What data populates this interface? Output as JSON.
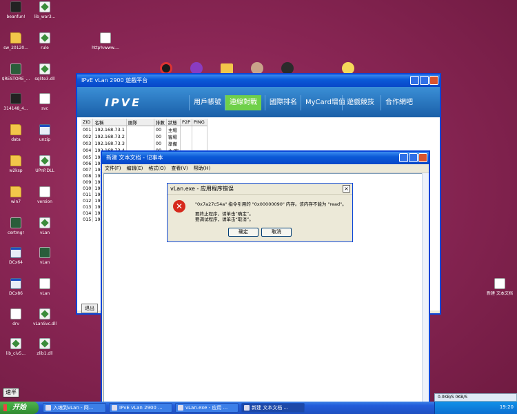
{
  "desktop": {
    "icons": [
      {
        "label": "beanfun!",
        "type": "dark"
      },
      {
        "label": "lib_war3...",
        "type": "dll"
      },
      {
        "label": "sw_20120...",
        "type": "folder"
      },
      {
        "label": "rule",
        "type": "dll"
      },
      {
        "label": "http%www....",
        "type": "txt"
      },
      {
        "label": "$RESTORE_...",
        "type": "app"
      },
      {
        "label": "sqlite3.dll",
        "type": "dll"
      },
      {
        "label": "314148_4...",
        "type": "dark"
      },
      {
        "label": "svc",
        "type": "txt"
      },
      {
        "label": "data",
        "type": "folder"
      },
      {
        "label": "unzip",
        "type": "exe"
      },
      {
        "label": "w2ksp",
        "type": "folder"
      },
      {
        "label": "UPnP.DLL",
        "type": "dll"
      },
      {
        "label": "win7",
        "type": "folder"
      },
      {
        "label": "version",
        "type": "txt"
      },
      {
        "label": "certmgr",
        "type": "app"
      },
      {
        "label": "vLan",
        "type": "dll"
      },
      {
        "label": "DCx64",
        "type": "exe"
      },
      {
        "label": "vLan",
        "type": "app"
      },
      {
        "label": "DCx86",
        "type": "exe"
      },
      {
        "label": "vLan",
        "type": "txt"
      },
      {
        "label": "drv",
        "type": "txt"
      },
      {
        "label": "vLanSvc.dll",
        "type": "dll"
      },
      {
        "label": "lib_civ5...",
        "type": "dll"
      },
      {
        "label": "zlib1.dll",
        "type": "dll"
      },
      {
        "label": "新建 文本文档",
        "type": "txt"
      }
    ]
  },
  "ipve_window": {
    "title": "IPvE vLan 2900 遊戲平台",
    "logo": "IPVE",
    "tabs": [
      {
        "label": "用戶帳號"
      },
      {
        "label": "連線對戰"
      },
      {
        "label": "國際排名"
      },
      {
        "label": "MyCard增值"
      },
      {
        "label": "遊戲競技"
      },
      {
        "label": "合作網吧"
      }
    ],
    "table": {
      "headers": [
        "ZID",
        "名稱",
        "團隊",
        "排數",
        "狀態",
        "P2P",
        "PING"
      ],
      "rows": [
        [
          "001",
          "192.168.73.1",
          "",
          "00",
          "主場",
          "",
          ""
        ],
        [
          "002",
          "192.168.73.2",
          "",
          "00",
          "客場",
          "",
          ""
        ],
        [
          "003",
          "192.168.73.3",
          "",
          "00",
          "準備",
          "",
          ""
        ],
        [
          "004",
          "192.168.73.4",
          "",
          "00",
          "主/客",
          "",
          ""
        ],
        [
          "005",
          "19",
          "",
          "",
          "",
          "",
          ""
        ],
        [
          "006",
          "19",
          "",
          "",
          "",
          "",
          ""
        ],
        [
          "007",
          "19",
          "",
          "",
          "",
          "",
          ""
        ],
        [
          "008",
          "19",
          "",
          "",
          "",
          "",
          ""
        ],
        [
          "009",
          "19",
          "",
          "",
          "",
          "",
          ""
        ],
        [
          "010",
          "19",
          "",
          "",
          "",
          "",
          ""
        ],
        [
          "011",
          "19",
          "",
          "",
          "",
          "",
          ""
        ],
        [
          "012",
          "19",
          "",
          "",
          "",
          "",
          ""
        ],
        [
          "013",
          "19",
          "",
          "",
          "",
          "",
          ""
        ],
        [
          "014",
          "19",
          "",
          "",
          "",
          "",
          ""
        ],
        [
          "015",
          "19",
          "",
          "",
          "",
          "",
          ""
        ]
      ]
    },
    "exit_label": "退出"
  },
  "notepad": {
    "title": "新建 文本文档 - 记事本",
    "menu": [
      "文件(F)",
      "编辑(E)",
      "格式(O)",
      "查看(V)",
      "帮助(H)"
    ]
  },
  "error_dialog": {
    "title": "vLan.exe - 应用程序错误",
    "message1": "\"0x7a27c54a\" 指令引用的 \"0x00000090\" 内存。该内存不能为 \"read\"。",
    "message2": "要终止程序，请单击“确定”。",
    "message3": "要调试程序，请单击“取消”。",
    "ok_label": "确定",
    "cancel_label": "取消"
  },
  "taskbar": {
    "start_label": "开始",
    "buttons": [
      {
        "label": "入魂到vLan - 网..."
      },
      {
        "label": "IPvE vLan 2900 ..."
      },
      {
        "label": "vLan.exe - 应用 ..."
      },
      {
        "label": "新建 文本文档 ..."
      }
    ],
    "clock": "19:20",
    "netmon": "0.0KB/S    0KB/S",
    "ime": "速半"
  }
}
